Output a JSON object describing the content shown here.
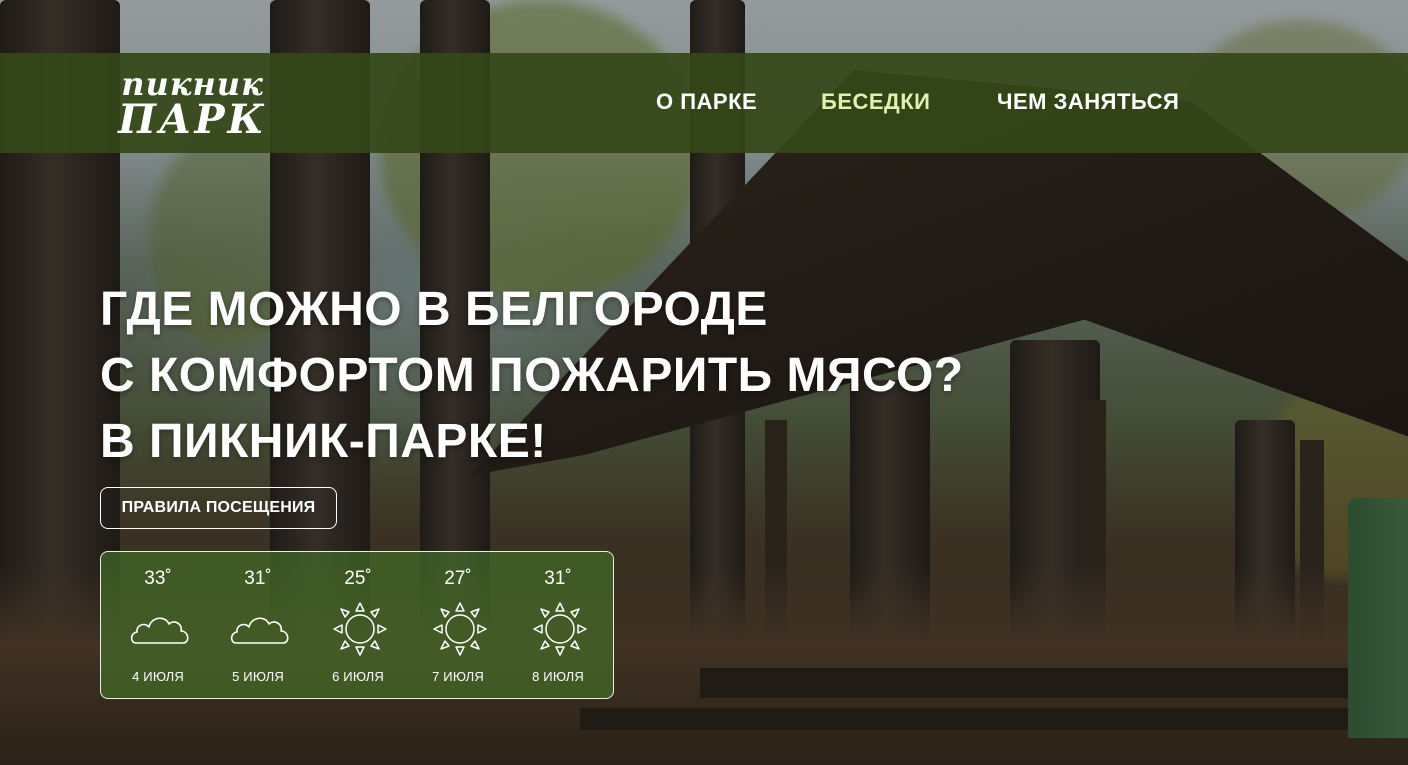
{
  "logo": {
    "line1": "пикник",
    "line2": "ПАРК"
  },
  "nav": {
    "items": [
      {
        "label": "О ПАРКЕ",
        "active": false
      },
      {
        "label": "БЕСЕДКИ",
        "active": true
      },
      {
        "label": "ЧЕМ ЗАНЯТЬСЯ",
        "active": false
      }
    ]
  },
  "hero": {
    "line1": "ГДЕ МОЖНО В БЕЛГОРОДЕ",
    "line2": "С КОМФОРТОМ ПОЖАРИТЬ МЯСО?",
    "line3": "В ПИКНИК-ПАРКЕ!",
    "rules_button": "ПРАВИЛА ПОСЕЩЕНИЯ"
  },
  "weather": {
    "days": [
      {
        "temp": "33˚",
        "icon": "cloud-icon",
        "date": "4 ИЮЛЯ"
      },
      {
        "temp": "31˚",
        "icon": "cloud-icon",
        "date": "5 ИЮЛЯ"
      },
      {
        "temp": "25˚",
        "icon": "sun-icon",
        "date": "6 ИЮЛЯ"
      },
      {
        "temp": "27˚",
        "icon": "sun-icon",
        "date": "7 ИЮЛЯ"
      },
      {
        "temp": "31˚",
        "icon": "sun-icon",
        "date": "8 ИЮЛЯ"
      }
    ]
  },
  "colors": {
    "header_bg": "#344818",
    "nav_active": "#dff2b0",
    "weather_bg": "#446e28"
  }
}
